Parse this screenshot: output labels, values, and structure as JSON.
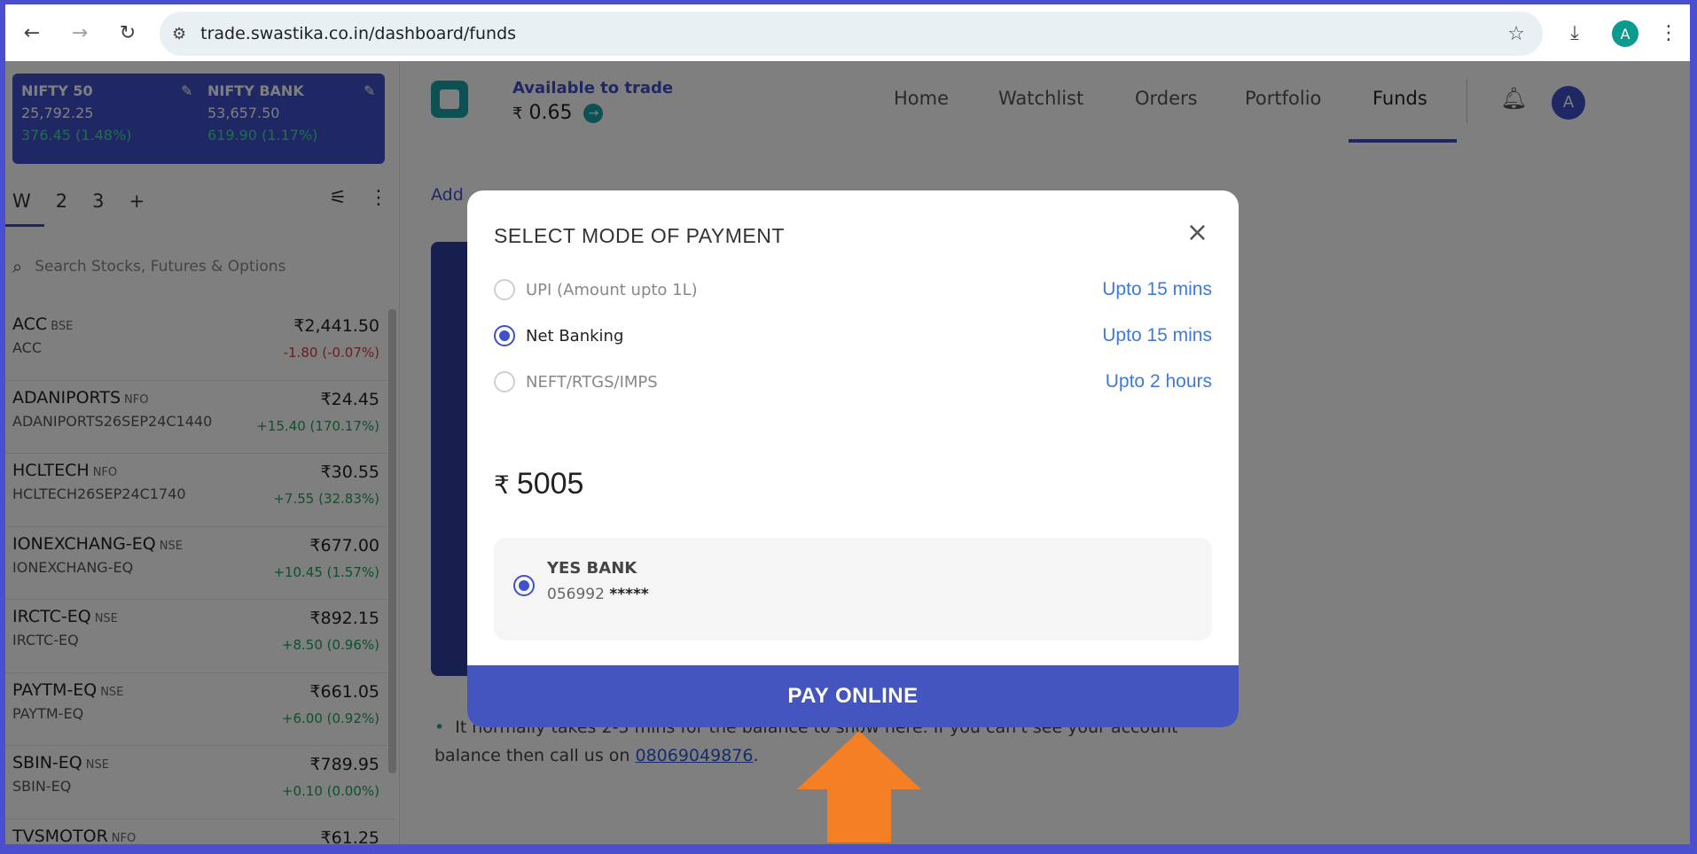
{
  "browser": {
    "url": "trade.swastika.co.in/dashboard/funds",
    "profile_initial": "A"
  },
  "indices": [
    {
      "name": "NIFTY 50",
      "value": "25,792.25",
      "change": "376.45 (1.48%)"
    },
    {
      "name": "NIFTY BANK",
      "value": "53,657.50",
      "change": "619.90 (1.17%)"
    }
  ],
  "watchlist_tabs": [
    "W",
    "2",
    "3",
    "+"
  ],
  "search": {
    "placeholder": "Search Stocks, Futures & Options"
  },
  "stocks": [
    {
      "symbol": "ACC",
      "exchange": "BSE",
      "sub": "ACC",
      "price": "₹2,441.50",
      "change": "-1.80 (-0.07%)",
      "dir": "down"
    },
    {
      "symbol": "ADANIPORTS",
      "exchange": "NFO",
      "sub": "ADANIPORTS26SEP24C1440",
      "price": "₹24.45",
      "change": "+15.40 (170.17%)",
      "dir": "up"
    },
    {
      "symbol": "HCLTECH",
      "exchange": "NFO",
      "sub": "HCLTECH26SEP24C1740",
      "price": "₹30.55",
      "change": "+7.55 (32.83%)",
      "dir": "up"
    },
    {
      "symbol": "IONEXCHANG-EQ",
      "exchange": "NSE",
      "sub": "IONEXCHANG-EQ",
      "price": "₹677.00",
      "change": "+10.45 (1.57%)",
      "dir": "up"
    },
    {
      "symbol": "IRCTC-EQ",
      "exchange": "NSE",
      "sub": "IRCTC-EQ",
      "price": "₹892.15",
      "change": "+8.50 (0.96%)",
      "dir": "up"
    },
    {
      "symbol": "PAYTM-EQ",
      "exchange": "NSE",
      "sub": "PAYTM-EQ",
      "price": "₹661.05",
      "change": "+6.00 (0.92%)",
      "dir": "up"
    },
    {
      "symbol": "SBIN-EQ",
      "exchange": "NSE",
      "sub": "SBIN-EQ",
      "price": "₹789.95",
      "change": "+0.10 (0.00%)",
      "dir": "up"
    },
    {
      "symbol": "TVSMOTOR",
      "exchange": "NFO",
      "sub": "",
      "price": "₹61.25",
      "change": "",
      "dir": "up"
    }
  ],
  "header": {
    "available_label": "Available to trade",
    "currency": "₹",
    "available_amount": "0.65",
    "nav": [
      "Home",
      "Watchlist",
      "Orders",
      "Portfolio",
      "Funds"
    ],
    "user_initial": "A"
  },
  "funds": {
    "tab_add": "Add",
    "note_text": "It normally takes 2-5 mins for the balance to show here. If you can't see your account balance then call us on ",
    "phone": "08069049876",
    "note_end": "."
  },
  "modal": {
    "title": "SELECT MODE OF PAYMENT",
    "close": "×",
    "options": [
      {
        "label": "UPI (Amount upto 1L)",
        "time": "Upto 15 mins"
      },
      {
        "label": "Net Banking",
        "time": "Upto 15 mins"
      },
      {
        "label": "NEFT/RTGS/IMPS",
        "time": "Upto 2 hours"
      }
    ],
    "currency": "₹",
    "amount": "5005",
    "bank": {
      "name": "YES BANK",
      "acc_prefix": "056992",
      "acc_mask": "*****"
    },
    "pay_label": "PAY ONLINE"
  }
}
